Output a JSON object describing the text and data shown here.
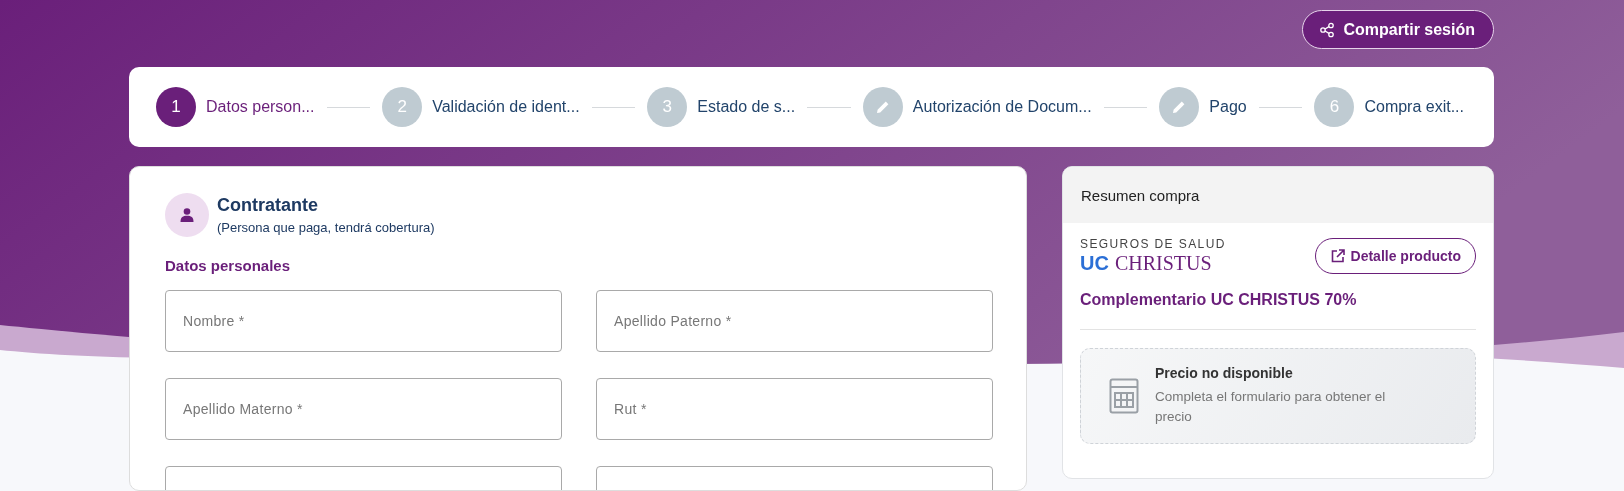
{
  "header": {
    "share_button": "Compartir sesión"
  },
  "steps": [
    {
      "kind": "number",
      "number": "1",
      "label": "Datos person...",
      "selected": true
    },
    {
      "kind": "number",
      "number": "2",
      "label": "Validación de ident...",
      "selected": false
    },
    {
      "kind": "number",
      "number": "3",
      "label": "Estado de s...",
      "selected": false
    },
    {
      "kind": "edit",
      "label": "Autorización de Docum...",
      "selected": false
    },
    {
      "kind": "edit",
      "label": "Pago",
      "selected": false
    },
    {
      "kind": "number",
      "number": "6",
      "label": "Compra exit...",
      "selected": false
    }
  ],
  "form": {
    "title": "Contratante",
    "subtitle": "(Persona que paga, tendrá cobertura)",
    "section": "Datos personales",
    "fields": [
      {
        "kind": "text",
        "placeholder": "Nombre *"
      },
      {
        "kind": "text",
        "placeholder": "Apellido Paterno *"
      },
      {
        "kind": "text",
        "placeholder": "Apellido Materno *"
      },
      {
        "kind": "text",
        "placeholder": "Rut *"
      },
      {
        "kind": "text"
      },
      {
        "kind": "text"
      }
    ]
  },
  "summary": {
    "title": "Resumen compra",
    "logo": {
      "tagline": "SEGUROS DE SALUD",
      "mark_left": "UC",
      "mark_right": "CHRISTUS"
    },
    "detail_button": "Detalle producto",
    "product": "Complementario UC CHRISTUS 70%",
    "price_notice": {
      "title": "Precio no disponible",
      "text": "Completa el formulario para obtener el precio"
    }
  }
}
